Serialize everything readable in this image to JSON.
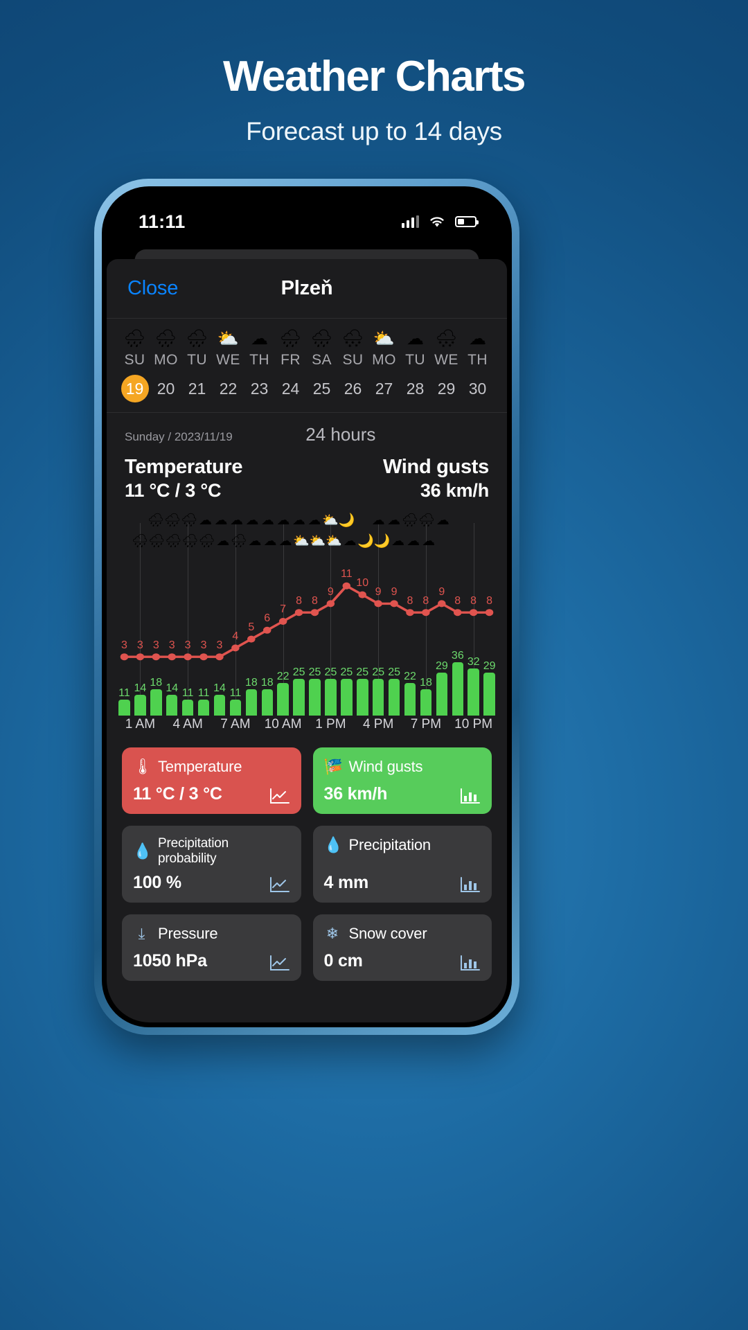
{
  "promo": {
    "title": "Weather Charts",
    "subtitle": "Forecast up to 14 days"
  },
  "status_bar": {
    "time": "11:11",
    "signal_icon": "cellular-signal-icon",
    "wifi_icon": "wifi-icon",
    "battery_icon": "battery-icon"
  },
  "navbar": {
    "close_label": "Close",
    "title": "Plzeň"
  },
  "day_strip": {
    "days": [
      {
        "dow": "SU",
        "num": "19",
        "icon": "🌧",
        "selected": true
      },
      {
        "dow": "MO",
        "num": "20",
        "icon": "🌧",
        "selected": false
      },
      {
        "dow": "TU",
        "num": "21",
        "icon": "🌧",
        "selected": false
      },
      {
        "dow": "WE",
        "num": "22",
        "icon": "⛅",
        "selected": false
      },
      {
        "dow": "TH",
        "num": "23",
        "icon": "☁",
        "selected": false
      },
      {
        "dow": "FR",
        "num": "24",
        "icon": "🌧",
        "selected": false
      },
      {
        "dow": "SA",
        "num": "25",
        "icon": "🌧",
        "selected": false
      },
      {
        "dow": "SU",
        "num": "26",
        "icon": "🌨",
        "selected": false
      },
      {
        "dow": "MO",
        "num": "27",
        "icon": "⛅",
        "selected": false
      },
      {
        "dow": "TU",
        "num": "28",
        "icon": "☁",
        "selected": false
      },
      {
        "dow": "WE",
        "num": "29",
        "icon": "🌨",
        "selected": false
      },
      {
        "dow": "TH",
        "num": "30",
        "icon": "☁",
        "selected": false
      }
    ]
  },
  "detail": {
    "date_label": "Sunday / 2023/11/19",
    "range_label": "24 hours",
    "temperature_label": "Temperature",
    "temperature_value": "11 °C / 3 °C",
    "wind_label": "Wind gusts",
    "wind_value": "36 km/h"
  },
  "chart_data": {
    "type": "line",
    "title": "24 hours",
    "xlabel": "",
    "ylabel": "",
    "x": [
      "12 AM",
      "1 AM",
      "2 AM",
      "3 AM",
      "4 AM",
      "5 AM",
      "6 AM",
      "7 AM",
      "8 AM",
      "9 AM",
      "10 AM",
      "11 AM",
      "12 PM",
      "1 PM",
      "2 PM",
      "3 PM",
      "4 PM",
      "5 PM",
      "6 PM",
      "7 PM",
      "8 PM",
      "9 PM",
      "10 PM",
      "11 PM"
    ],
    "tick_labels": [
      "1 AM",
      "4 AM",
      "7 AM",
      "10 AM",
      "1 PM",
      "4 PM",
      "7 PM",
      "10 PM"
    ],
    "tick_positions": [
      1,
      4,
      7,
      10,
      13,
      16,
      19,
      22
    ],
    "grid": true,
    "legend": "none",
    "series": [
      {
        "name": "Temperature",
        "type": "line",
        "unit": "°C",
        "color": "#e0544f",
        "values": [
          3,
          3,
          3,
          3,
          3,
          3,
          3,
          4,
          5,
          6,
          7,
          8,
          8,
          9,
          11,
          10,
          9,
          9,
          8,
          8,
          9,
          8,
          8,
          8
        ],
        "ylim": [
          2,
          12
        ]
      },
      {
        "name": "Wind gusts",
        "type": "bar",
        "unit": "km/h",
        "color": "#4fd14f",
        "values": [
          11,
          14,
          18,
          14,
          11,
          11,
          14,
          11,
          18,
          18,
          22,
          25,
          25,
          25,
          25,
          25,
          25,
          25,
          22,
          18,
          29,
          36,
          32,
          29
        ],
        "ylim": [
          0,
          40
        ]
      }
    ],
    "hour_icons_top": [
      "",
      "",
      "🌧",
      "🌧",
      "🌧",
      "☁",
      "☁",
      "☁",
      "☁",
      "☁",
      "☁",
      "☁",
      "☁",
      "⛅",
      "🌙",
      "",
      "☁",
      "☁",
      "🌧",
      "🌧",
      "☁",
      "",
      "",
      ""
    ],
    "hour_icons_bottom": [
      "",
      "🌧",
      "🌧",
      "🌧",
      "🌧",
      "🌧",
      "☁",
      "🌧",
      "☁",
      "☁",
      "☁",
      "⛅",
      "⛅",
      "⛅",
      "☁",
      "🌙",
      "🌙",
      "☁",
      "☁",
      "☁",
      "",
      "",
      "",
      ""
    ]
  },
  "cards": [
    {
      "icon": "thermometer-icon",
      "glyph": "🌡",
      "title": "Temperature",
      "value": "11 °C / 3 °C",
      "style": "accent-red",
      "chart_icon": "line-chart-icon",
      "size": "large"
    },
    {
      "icon": "wind-gust-icon",
      "glyph": "🎏",
      "title": "Wind gusts",
      "value": "36 km/h",
      "style": "accent-green",
      "chart_icon": "bar-chart-icon",
      "size": "large"
    },
    {
      "icon": "droplet-icon",
      "glyph": "💧",
      "title": "Precipitation probability",
      "value": "100 %",
      "style": "plain",
      "chart_icon": "line-chart-icon",
      "size": "small"
    },
    {
      "icon": "droplet-icon",
      "glyph": "💧",
      "title": "Precipitation",
      "value": "4 mm",
      "style": "plain",
      "chart_icon": "bar-chart-icon",
      "size": "large"
    },
    {
      "icon": "pressure-download-icon",
      "glyph": "⤓",
      "title": "Pressure",
      "value": "1050 hPa",
      "style": "plain",
      "chart_icon": "line-chart-icon",
      "size": "large"
    },
    {
      "icon": "snowflake-icon",
      "glyph": "❄",
      "title": "Snow cover",
      "value": "0 cm",
      "style": "plain",
      "chart_icon": "bar-chart-icon",
      "size": "large"
    }
  ],
  "colors": {
    "accent_blue": "#0a84ff",
    "selected_day": "#f5a623",
    "temperature": "#e0544f",
    "wind": "#4fd14f",
    "sheet_bg": "#1c1c1e"
  }
}
